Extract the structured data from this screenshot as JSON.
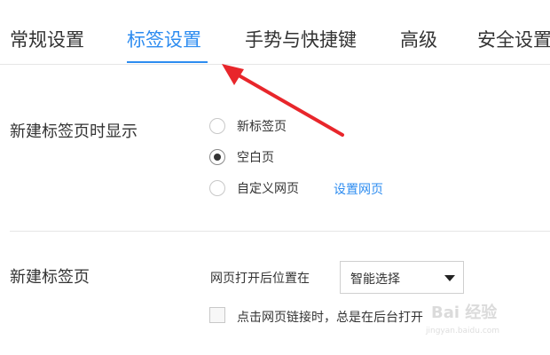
{
  "tabs": [
    {
      "label": "常规设置"
    },
    {
      "label": "标签设置"
    },
    {
      "label": "手势与快捷键"
    },
    {
      "label": "高级"
    },
    {
      "label": "安全设置"
    }
  ],
  "new_tab_display": {
    "title": "新建标签页时显示",
    "options": [
      {
        "label": "新标签页",
        "checked": false
      },
      {
        "label": "空白页",
        "checked": true
      },
      {
        "label": "自定义网页",
        "checked": false
      }
    ],
    "set_page_link": "设置网页"
  },
  "new_tab": {
    "title": "新建标签页",
    "position_label": "网页打开后位置在",
    "position_select_value": "智能选择",
    "background_open_label": "点击网页链接时，总是在后台打开"
  },
  "watermark": {
    "main": "Bai 经验",
    "sub": "jingyan.baidu.com"
  },
  "colors": {
    "accent": "#2d8cf0",
    "annotation_arrow": "#e8262b"
  }
}
